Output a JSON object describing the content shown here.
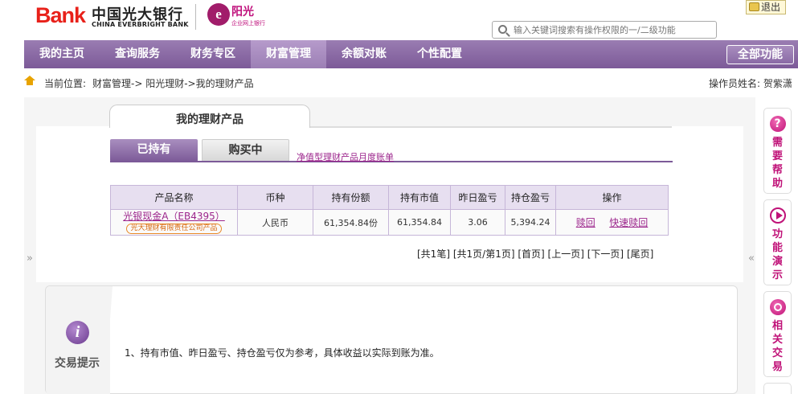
{
  "header": {
    "logo_bank": "Bank",
    "logo_cn": "中国光大银行",
    "logo_en": "CHINA EVERBRIGHT BANK",
    "sub_logo_mark": "e",
    "sub_logo_title": "阳光",
    "sub_logo_subtitle": "企业网上银行",
    "logout_label": "退出",
    "search_placeholder": "输入关键词搜索有操作权限的一/二级功能"
  },
  "nav": {
    "items": [
      "我的主页",
      "查询服务",
      "财务专区",
      "财富管理",
      "余额对账",
      "个性配置"
    ],
    "active": "财富管理",
    "all_functions": "全部功能"
  },
  "breadcrumb": {
    "label": "当前位置:",
    "path": "财富管理->  阳光理财->我的理财产品",
    "operator": "操作员姓名: 贺紫潇"
  },
  "page": {
    "title": "我的理财产品",
    "tab_held": "已持有",
    "tab_buying": "购买中",
    "link_monthly": "净值型理财产品月度账单"
  },
  "table": {
    "headers": [
      "产品名称",
      "币种",
      "持有份额",
      "持有市值",
      "昨日盈亏",
      "持仓盈亏",
      "操作"
    ],
    "rows": [
      {
        "name": "光银现金A（EB4395）",
        "issuer": "光大理财有限责任公司产品",
        "currency": "人民币",
        "shares": "61,354.84份",
        "market_value": "61,354.84",
        "yesterday_pl": "3.06",
        "position_pl": "5,394.24",
        "op_redeem": "赎回",
        "op_fast_redeem": "快速赎回"
      }
    ]
  },
  "pager": {
    "total": "[共1笔]",
    "pages": "[共1页/第1页]",
    "first": "[首页]",
    "prev": "[上一页]",
    "next": "[下一页]",
    "last": "[尾页]"
  },
  "tips": {
    "icon_letter": "i",
    "label": "交易提示",
    "text": "1、持有市值、昨日盈亏、持仓盈亏仅为参考，具体收益以实际到账为准。"
  },
  "side": {
    "collapse_left": "»",
    "collapse_right": "«",
    "help_mark": "?",
    "help": "需要帮助",
    "demo": "功能演示",
    "related": "相关交易"
  },
  "colors": {
    "nav_purple": "#7c5a98",
    "link_purple": "#9c258c",
    "brand_red": "#e8211a",
    "accent_magenta": "#c01278"
  }
}
